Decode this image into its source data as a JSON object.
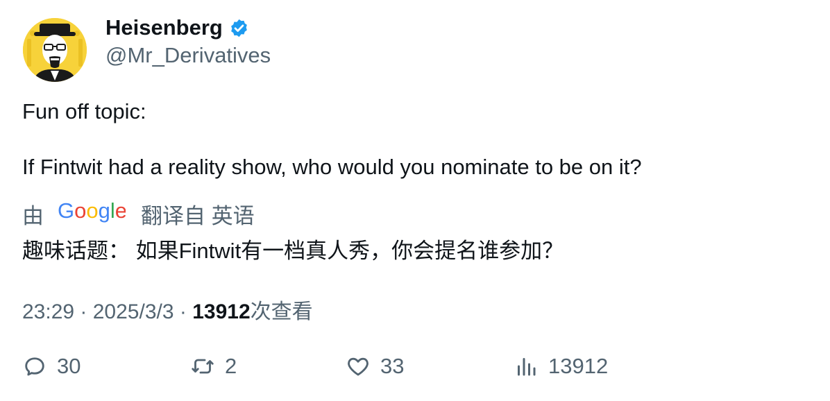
{
  "author": {
    "display_name": "Heisenberg",
    "handle": "@Mr_Derivatives",
    "verified": true,
    "avatar_icon": "heisenberg-avatar-icon",
    "avatar_bg": "#f7d23a",
    "verified_color": "#1d9bf0"
  },
  "tweet": {
    "line1": "Fun off topic:",
    "line2": "If Fintwit had a reality show, who would you nominate to be on it?"
  },
  "translation": {
    "prefix": "由",
    "provider_icon": "google-logo",
    "suffix": "翻译自 英语",
    "text": "趣味话题： 如果Fintwit有一档真人秀，你会提名谁参加？"
  },
  "meta": {
    "time": "23:29",
    "sep1": " · ",
    "date": "2025/3/3",
    "sep2": " · ",
    "views": "13912",
    "views_label": "次查看"
  },
  "actions": {
    "reply": {
      "icon": "reply-icon",
      "count": "30"
    },
    "retweet": {
      "icon": "retweet-icon",
      "count": "2"
    },
    "like": {
      "icon": "heart-icon",
      "count": "33"
    },
    "views": {
      "icon": "analytics-icon",
      "count": "13912"
    }
  },
  "colors": {
    "text": "#0f1419",
    "secondary": "#536471"
  }
}
